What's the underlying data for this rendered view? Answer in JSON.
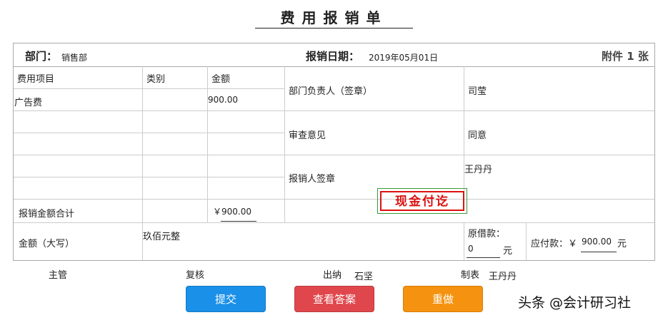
{
  "title": "费用报销单",
  "header": {
    "dept_label": "部门：",
    "dept_value": "销售部",
    "date_label": "报销日期：",
    "date_value": "2019年05月01日",
    "attach_label": "附件 1 张"
  },
  "table": {
    "col_item": "费用项目",
    "col_category": "类别",
    "col_amount": "金额",
    "rows": [
      {
        "item": "广告费",
        "category": "",
        "amount": "900.00"
      }
    ],
    "total_label": "报销金额合计",
    "total_value": "￥900.00",
    "capital_label": "金额（大写）",
    "capital_value": "玖佰元整",
    "dept_head_label": "部门负责人（签章）",
    "dept_head_value": "司莹",
    "review_label": "审查意见",
    "review_value": "同意",
    "claimant_label": "报销人签章",
    "claimant_value": "王丹丹",
    "advance_label": "原借款：",
    "advance_value": "0",
    "advance_unit": "元",
    "payable_label": "应付款：￥",
    "payable_value": "900.00",
    "payable_unit": "元"
  },
  "stamp": "现金付讫",
  "footer": {
    "supervisor_label": "主管",
    "checker_label": "复核",
    "cashier_label": "出纳",
    "cashier_value": "石坚",
    "preparer_label": "制表",
    "preparer_value": "王丹丹"
  },
  "buttons": {
    "submit": "提交",
    "view_answer": "查看答案",
    "redo": "重做"
  },
  "colors": {
    "submit": "#1a90e8",
    "view_answer": "#e0474c",
    "redo": "#f5920f",
    "stamp": "#dd1111"
  },
  "watermark": "头条 @会计研习社"
}
